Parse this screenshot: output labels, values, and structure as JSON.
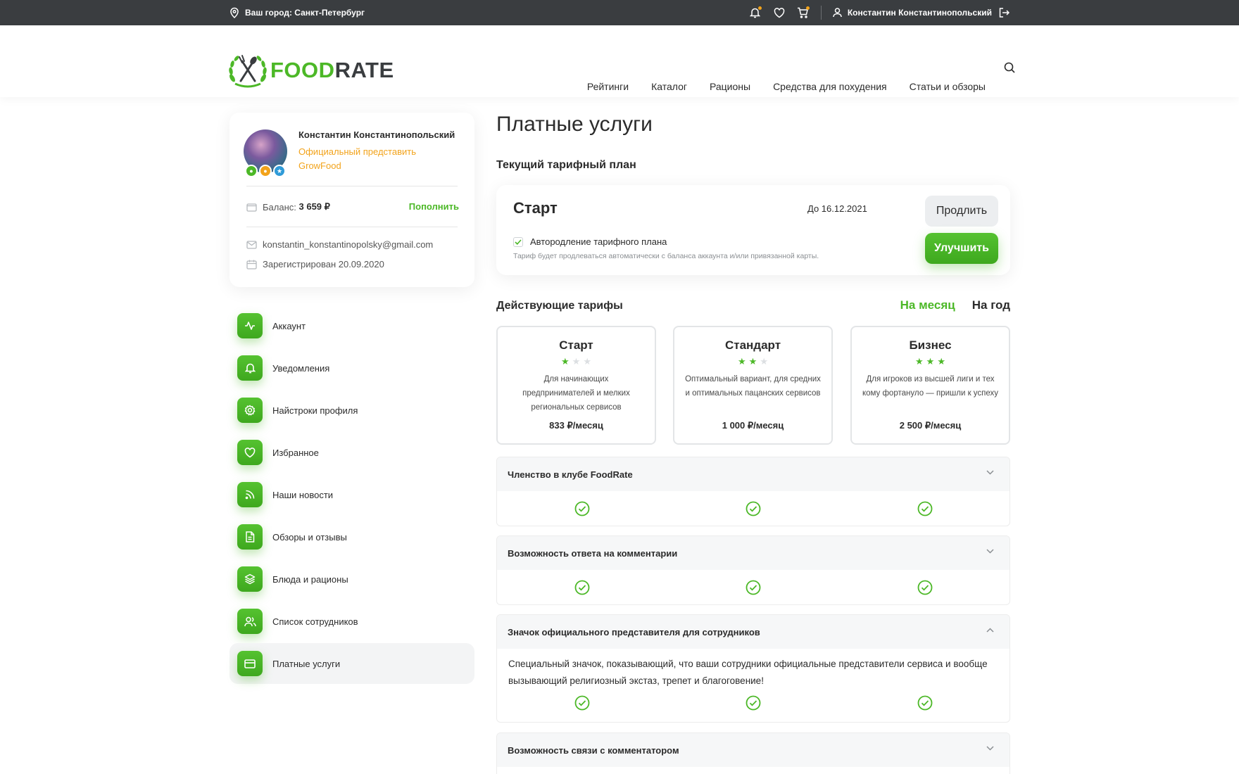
{
  "topbar": {
    "city": "Ваш город: Санкт-Петербург",
    "user_name": "Константин Константинопольский"
  },
  "header": {
    "logo_food": "FOOD",
    "logo_rate": "RATE",
    "nav": [
      "Рейтинги",
      "Каталог",
      "Рационы",
      "Средства для похудения",
      "Статьи и обзоры"
    ]
  },
  "profile": {
    "name": "Константин Константинопольский",
    "role": "Официальный представить GrowFood",
    "balance_label": "Баланс:",
    "balance_value": "3 659 ₽",
    "topup": "Пополнить",
    "email": "konstantin_konstantinopolsky@gmail.com",
    "registered": "Зарегистрирован 20.09.2020",
    "badge_colors": [
      "#4cb827",
      "#f2a31b",
      "#2f9bd8"
    ]
  },
  "menu": [
    {
      "label": "Аккаунт",
      "icon": "activity-icon"
    },
    {
      "label": "Уведомления",
      "icon": "bell-icon"
    },
    {
      "label": "Найстроки профиля",
      "icon": "gear-icon"
    },
    {
      "label": "Избранное",
      "icon": "heart-icon"
    },
    {
      "label": "Наши новости",
      "icon": "rss-icon"
    },
    {
      "label": "Обзоры и отзывы",
      "icon": "document-icon"
    },
    {
      "label": "Блюда и рационы",
      "icon": "layers-icon"
    },
    {
      "label": "Список сотрудников",
      "icon": "users-icon"
    },
    {
      "label": "Платные услуги",
      "icon": "credit-card-icon",
      "active": true
    }
  ],
  "main": {
    "title": "Платные услуги",
    "current_plan_title": "Текущий тарифный план",
    "plan": {
      "name": "Старт",
      "until": "До 16.12.2021",
      "autorenew_label": "Автородление тарифного плана",
      "autorenew_checked": true,
      "note": "Тариф будет продлеваться автоматически с баланса аккаунта и/или привязанной карты.",
      "extend_button": "Продлить",
      "upgrade_button": "Улучшить"
    },
    "tariffs_title": "Действующие тарифы",
    "period": {
      "month": "На месяц",
      "year": "На год",
      "selected": "month"
    },
    "tariffs": [
      {
        "name": "Старт",
        "stars": 1,
        "desc": "Для начинающих предпринимателей и мелких региональных сервисов",
        "price": "833 ₽/месяц"
      },
      {
        "name": "Стандарт",
        "stars": 2,
        "desc": "Оптимальный вариант, для средних и оптимальных пацанских сервисов",
        "price": "1 000 ₽/месяц"
      },
      {
        "name": "Бизнес",
        "stars": 3,
        "desc": "Для игроков из высшей лиги и тех кому фортануло — пришли к успеху",
        "price": "2 500 ₽/месяц"
      }
    ],
    "features": [
      {
        "title": "Членство в клубе FoodRate",
        "expanded": false
      },
      {
        "title": "Возможность ответа на комментарии",
        "expanded": false
      },
      {
        "title": "Значок официального представителя для сотрудников",
        "expanded": true,
        "description": "Специальный значок, показывающий, что ваши сотрудники официальные представители сервиса и вообще вызывающий религиозный экстаз, трепет и благоговение!"
      },
      {
        "title": "Возможность связи с комментатором",
        "expanded": false
      }
    ]
  },
  "colors": {
    "accent": "#4cb827",
    "orange": "#f2a31b",
    "dark": "#3a3d40"
  }
}
